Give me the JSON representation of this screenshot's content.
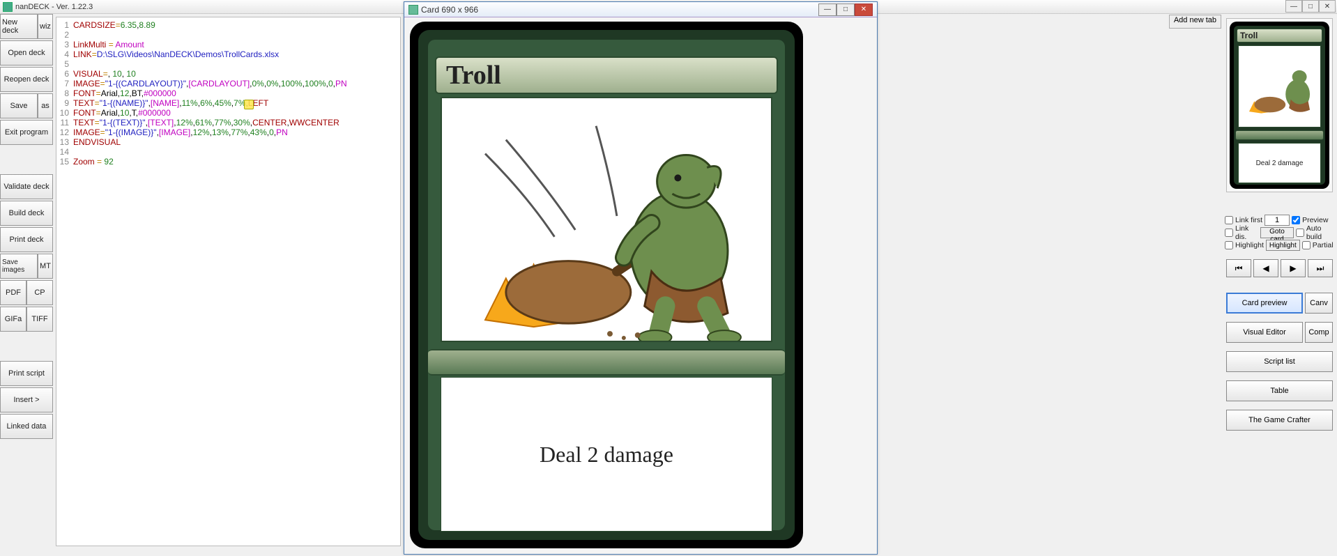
{
  "app": {
    "title": "nanDECK - Ver. 1.22.3"
  },
  "win_buttons": {
    "min": "—",
    "max": "□",
    "close": "✕"
  },
  "sidebar": {
    "new_deck": "New deck",
    "wiz": "wiz",
    "open_deck": "Open deck",
    "reopen_deck": "Reopen deck",
    "save": "Save",
    "as": "as",
    "exit": "Exit program",
    "validate": "Validate deck",
    "build": "Build deck",
    "print": "Print deck",
    "save_images": "Save images",
    "mt": "MT",
    "pdf": "PDF",
    "cp": "CP",
    "gifa": "GIFa",
    "tiff": "TIFF",
    "print_script": "Print script",
    "insert": "Insert >",
    "linked_data": "Linked data"
  },
  "code": [
    {
      "n": 1,
      "tokens": [
        [
          "kw",
          "CARDSIZE"
        ],
        [
          "op",
          "="
        ],
        [
          "num",
          "6.35"
        ],
        [
          "",
          ","
        ],
        [
          "num",
          "8.89"
        ]
      ]
    },
    {
      "n": 2,
      "tokens": []
    },
    {
      "n": 3,
      "tokens": [
        [
          "kw",
          "LinkMulti"
        ],
        [
          "",
          " "
        ],
        [
          "op",
          "="
        ],
        [
          "",
          " "
        ],
        [
          "id",
          "Amount"
        ]
      ]
    },
    {
      "n": 4,
      "tokens": [
        [
          "kw",
          "LINK"
        ],
        [
          "op",
          "="
        ],
        [
          "str",
          "D:\\SLG\\Videos\\NanDECK\\Demos\\TrollCards.xlsx"
        ]
      ]
    },
    {
      "n": 5,
      "tokens": []
    },
    {
      "n": 6,
      "tokens": [
        [
          "kw",
          "VISUAL"
        ],
        [
          "op",
          "="
        ],
        [
          "",
          ", "
        ],
        [
          "num",
          "10"
        ],
        [
          "",
          ", "
        ],
        [
          "num",
          "10"
        ]
      ]
    },
    {
      "n": 7,
      "tokens": [
        [
          "kw",
          "IMAGE"
        ],
        [
          "op",
          "="
        ],
        [
          "str",
          "\"1-{(CARDLAYOUT)}\""
        ],
        [
          "",
          ","
        ],
        [
          "id",
          "[CARDLAYOUT]"
        ],
        [
          "",
          ","
        ],
        [
          "num",
          "0%"
        ],
        [
          "",
          ","
        ],
        [
          "num",
          "0%"
        ],
        [
          "",
          ","
        ],
        [
          "num",
          "100%"
        ],
        [
          "",
          ","
        ],
        [
          "num",
          "100%"
        ],
        [
          "",
          ","
        ],
        [
          "num",
          "0"
        ],
        [
          "",
          ","
        ],
        [
          "id",
          "PN"
        ]
      ]
    },
    {
      "n": 8,
      "tokens": [
        [
          "kw",
          "FONT"
        ],
        [
          "op",
          "="
        ],
        [
          "",
          "Arial,"
        ],
        [
          "num",
          "12"
        ],
        [
          "",
          ",BT,"
        ],
        [
          "id",
          "#000000"
        ]
      ]
    },
    {
      "n": 9,
      "tokens": [
        [
          "kw",
          "TEXT"
        ],
        [
          "op",
          "="
        ],
        [
          "str",
          "\"1-{(NAME)}\""
        ],
        [
          "",
          ","
        ],
        [
          "id",
          "[NAME]"
        ],
        [
          "",
          ","
        ],
        [
          "num",
          "11%"
        ],
        [
          "",
          ","
        ],
        [
          "num",
          "6%"
        ],
        [
          "",
          ","
        ],
        [
          "num",
          "45%"
        ],
        [
          "",
          ","
        ],
        [
          "num",
          "7%"
        ],
        [
          "",
          ","
        ],
        [
          "kw",
          "LEFT"
        ]
      ]
    },
    {
      "n": 10,
      "tokens": [
        [
          "kw",
          "FONT"
        ],
        [
          "op",
          "="
        ],
        [
          "",
          "Arial,"
        ],
        [
          "num",
          "10"
        ],
        [
          "",
          ",T,"
        ],
        [
          "id",
          "#000000"
        ]
      ]
    },
    {
      "n": 11,
      "tokens": [
        [
          "kw",
          "TEXT"
        ],
        [
          "op",
          "="
        ],
        [
          "str",
          "\"1-{(TEXT)}\""
        ],
        [
          "",
          ","
        ],
        [
          "id",
          "[TEXT]"
        ],
        [
          "",
          ","
        ],
        [
          "num",
          "12%"
        ],
        [
          "",
          ","
        ],
        [
          "num",
          "61%"
        ],
        [
          "",
          ","
        ],
        [
          "num",
          "77%"
        ],
        [
          "",
          ","
        ],
        [
          "num",
          "30%"
        ],
        [
          "",
          ","
        ],
        [
          "kw",
          "CENTER"
        ],
        [
          "",
          ","
        ],
        [
          "kw",
          "WWCENTER"
        ]
      ]
    },
    {
      "n": 12,
      "tokens": [
        [
          "kw",
          "IMAGE"
        ],
        [
          "op",
          "="
        ],
        [
          "str",
          "\"1-{(IMAGE)}\""
        ],
        [
          "",
          ","
        ],
        [
          "id",
          "[IMAGE]"
        ],
        [
          "",
          ","
        ],
        [
          "num",
          "12%"
        ],
        [
          "",
          ","
        ],
        [
          "num",
          "13%"
        ],
        [
          "",
          ","
        ],
        [
          "num",
          "77%"
        ],
        [
          "",
          ","
        ],
        [
          "num",
          "43%"
        ],
        [
          "",
          ","
        ],
        [
          "num",
          "0"
        ],
        [
          "",
          ","
        ],
        [
          "id",
          "PN"
        ]
      ]
    },
    {
      "n": 13,
      "tokens": [
        [
          "kw",
          "ENDVISUAL"
        ]
      ]
    },
    {
      "n": 14,
      "tokens": []
    },
    {
      "n": 15,
      "tokens": [
        [
          "kw",
          "Zoom"
        ],
        [
          "",
          " "
        ],
        [
          "op",
          "="
        ],
        [
          "",
          " "
        ],
        [
          "num",
          "92"
        ]
      ]
    }
  ],
  "card_window": {
    "title": "Card 690 x 966"
  },
  "card": {
    "name": "Troll",
    "text": "Deal 2 damage"
  },
  "tabs": {
    "add": "Add new tab"
  },
  "opts": {
    "link_first": "Link first",
    "link_dis": "Link dis.",
    "highlight1": "Highlight",
    "preview": "Preview",
    "auto_build": "Auto build",
    "partial": "Partial",
    "card_num": "1",
    "goto": "Goto card",
    "highlight_btn": "Highlight"
  },
  "nav": {
    "first": "⏮",
    "prev": "◀",
    "next": "▶",
    "last": "⏭"
  },
  "right_buttons": {
    "card_preview": "Card preview",
    "canv": "Canv",
    "visual_editor": "Visual Editor",
    "comp": "Comp",
    "script_list": "Script list",
    "table": "Table",
    "game_crafter": "The Game Crafter"
  }
}
